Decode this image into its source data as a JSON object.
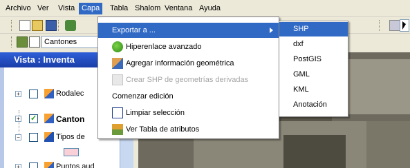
{
  "menubar": {
    "items": [
      "Archivo",
      "Ver",
      "Vista",
      "Capa",
      "Tabla",
      "Shalom",
      "Ventana",
      "Ayuda"
    ],
    "active_index": 3
  },
  "toolbar": {
    "layer_combo_value": "Cantones"
  },
  "document": {
    "title": "Vista : Inventa"
  },
  "toc": {
    "layers": [
      {
        "label": "Rodalec",
        "checked": false
      },
      {
        "label": "Canton",
        "checked": true,
        "bold": true
      },
      {
        "label": "Tipos de",
        "checked": false
      },
      {
        "label": "Puntos aud",
        "checked": false
      }
    ]
  },
  "capa_menu": {
    "items": [
      {
        "label": "Exportar a ...",
        "icon": "none",
        "has_submenu": true,
        "state": "highlighted"
      },
      {
        "label": "Hiperenlace avanzado",
        "icon": "hyperlink-icon",
        "state": "enabled"
      },
      {
        "label": "Agregar información geométrica",
        "icon": "geometry-icon",
        "state": "enabled"
      },
      {
        "label": "Crear SHP de geometrías derivadas",
        "icon": "shp-icon",
        "state": "disabled"
      },
      {
        "label": "Comenzar edición",
        "icon": "none",
        "state": "enabled"
      },
      {
        "label": "Limpiar selección",
        "icon": "clear-selection-icon",
        "state": "enabled"
      },
      {
        "label": "Ver Tabla de atributos",
        "icon": "attribute-table-icon",
        "state": "enabled"
      }
    ]
  },
  "export_submenu": {
    "items": [
      "SHP",
      "dxf",
      "PostGIS",
      "GML",
      "KML",
      "Anotación"
    ],
    "highlighted_index": 0
  },
  "colors": {
    "highlight": "#316AC5",
    "menu_bg": "#ECE9D8",
    "title_bar": "#2E5FD8"
  }
}
